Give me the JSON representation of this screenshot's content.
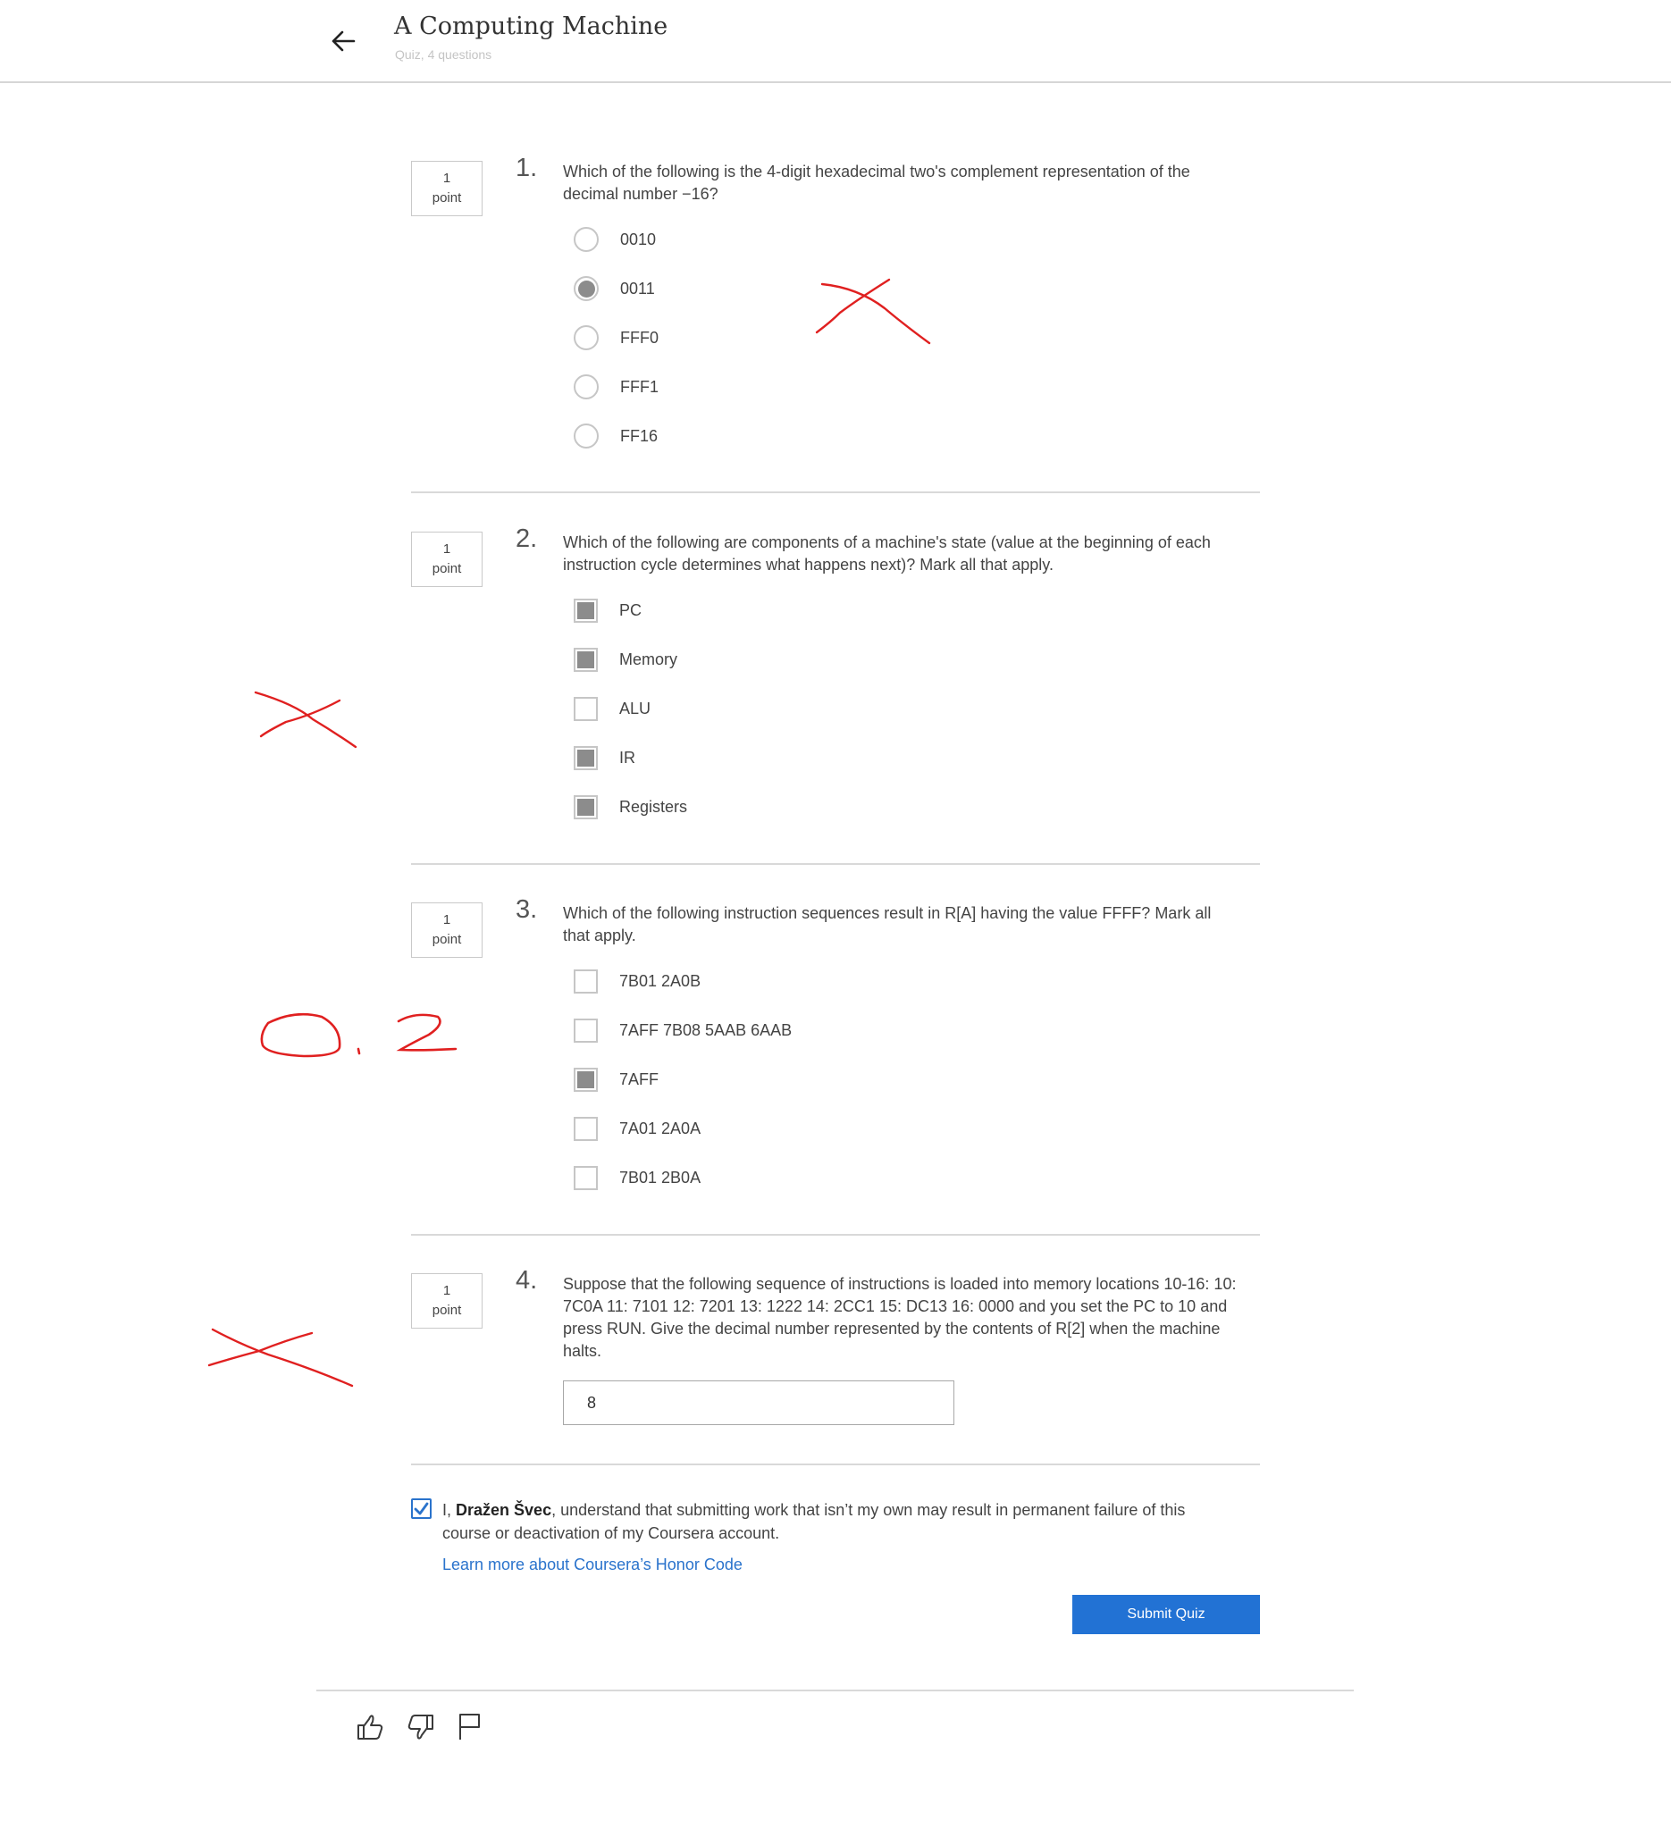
{
  "header": {
    "title": "A Computing Machine",
    "subtitle": "Quiz, 4 questions"
  },
  "questions": [
    {
      "number": "1.",
      "points": "1",
      "points_unit": "point",
      "text": "Which of the following is the 4-digit hexadecimal two's complement representation of the decimal number −16?",
      "type": "radio",
      "options": [
        {
          "label": "0010",
          "checked": false
        },
        {
          "label": "0011",
          "checked": true
        },
        {
          "label": "FFF0",
          "checked": false
        },
        {
          "label": "FFF1",
          "checked": false
        },
        {
          "label": "FF16",
          "checked": false
        }
      ]
    },
    {
      "number": "2.",
      "points": "1",
      "points_unit": "point",
      "text": "Which of the following are components of a machine's state (value at the beginning of each instruction cycle determines what happens next)? Mark all that apply.",
      "type": "checkbox",
      "options": [
        {
          "label": "PC",
          "checked": true
        },
        {
          "label": "Memory",
          "checked": true
        },
        {
          "label": "ALU",
          "checked": false
        },
        {
          "label": "IR",
          "checked": true
        },
        {
          "label": "Registers",
          "checked": true
        }
      ]
    },
    {
      "number": "3.",
      "points": "1",
      "points_unit": "point",
      "text": "Which of the following instruction sequences result in R[A] having the value FFFF? Mark all that apply.",
      "type": "checkbox",
      "options": [
        {
          "label": "7B01 2A0B",
          "checked": false
        },
        {
          "label": "7AFF 7B08 5AAB 6AAB",
          "checked": false
        },
        {
          "label": "7AFF",
          "checked": true
        },
        {
          "label": "7A01 2A0A",
          "checked": false
        },
        {
          "label": "7B01 2B0A",
          "checked": false
        }
      ]
    },
    {
      "number": "4.",
      "points": "1",
      "points_unit": "point",
      "text": "Suppose that the following sequence of instructions is loaded into memory locations 10-16: 10: 7C0A 11: 7101 12: 7201 13: 1222 14: 2CC1 15: DC13 16: 0000 and you set the PC to 10 and press RUN. Give the decimal number represented by the contents of R[2] when the machine halts.",
      "type": "text",
      "answer": "8"
    }
  ],
  "honor": {
    "prefix": "I, ",
    "name": "Dražen Švec",
    "suffix": ", understand that submitting work that isn’t my own may result in permanent failure of this course or deactivation of my Coursera account.",
    "checked": true,
    "link": "Learn more about Coursera’s Honor Code"
  },
  "submit_label": "Submit Quiz",
  "handwritten_annotations": {
    "score_text": "0.2",
    "color": "#e02020",
    "marks": [
      "cross-question-1",
      "cross-question-2",
      "score-question-3",
      "cross-question-4"
    ]
  },
  "icons": [
    "back-arrow-icon",
    "thumbs-up-icon",
    "thumbs-down-icon",
    "flag-icon",
    "checkmark-icon"
  ]
}
